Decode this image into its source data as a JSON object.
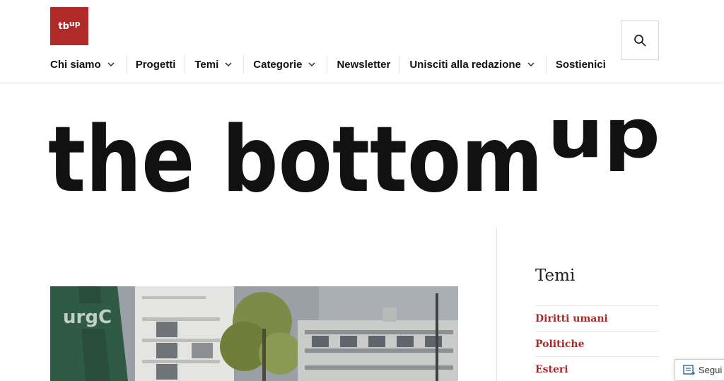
{
  "site": {
    "logo_text": "tb",
    "logo_sup": "up",
    "wordmark": "the bottom",
    "wordmark_sup": "up"
  },
  "nav": {
    "items": [
      {
        "label": "Chi siamo",
        "dropdown": true
      },
      {
        "label": "Progetti",
        "dropdown": false
      },
      {
        "label": "Temi",
        "dropdown": true
      },
      {
        "label": "Categorie",
        "dropdown": true
      },
      {
        "label": "Newsletter",
        "dropdown": false
      },
      {
        "label": "Unisciti alla redazione",
        "dropdown": true
      },
      {
        "label": "Sostienici",
        "dropdown": false
      }
    ],
    "search_icon": "search-icon"
  },
  "sidebar": {
    "title": "Temi",
    "items": [
      {
        "label": "Diritti umani"
      },
      {
        "label": "Politiche"
      },
      {
        "label": "Esteri"
      }
    ]
  },
  "follow": {
    "label": "Segui",
    "icon": "follow-icon"
  },
  "colors": {
    "brand": "#b02a2a",
    "link": "#a52a2a"
  }
}
